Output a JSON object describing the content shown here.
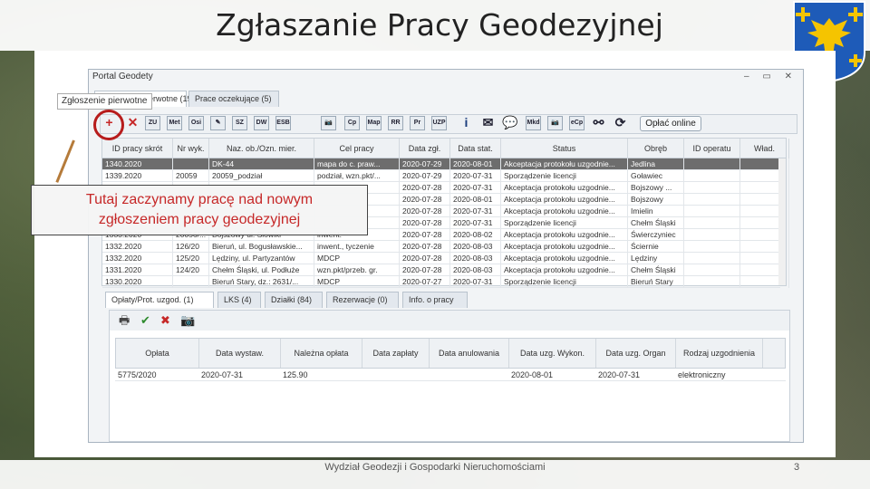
{
  "slide": {
    "title": "Zgłaszanie Pracy Geodezyjnej",
    "footer": "Wydział Geodezji i Gospodarki Nieruchomościami",
    "page": "3"
  },
  "window": {
    "title": "Portal Geodety",
    "controls": "– ▭ ✕"
  },
  "tabs": [
    {
      "label": "Zgłoszenie pierwotne (1900)"
    },
    {
      "label": "Prace oczekujące (5)"
    }
  ],
  "callout_tab": "Zgłoszenie pierwotne",
  "toolbar": {
    "icons": [
      "add-icon",
      "delete-icon",
      "zu-icon",
      "met-icon",
      "osi-icon",
      "edit-icon",
      "sz-icon",
      "dw-icon",
      "esb-icon",
      "camera-icon",
      "cp-icon",
      "map-icon",
      "rr-icon",
      "pr-icon",
      "uzp-icon",
      "info-icon",
      "mail-icon",
      "chat-icon",
      "mkd-icon",
      "photo-icon",
      "ecp-icon",
      "binoculars-icon",
      "refresh-icon"
    ],
    "labels": [
      "+",
      "✕",
      "ZU",
      "Met",
      "Osi",
      "✎",
      "SZ",
      "DW",
      "ESB",
      "📷",
      "Cp",
      "Map",
      "RR",
      "Pr",
      "UZP",
      "i",
      "✉",
      "💬",
      "Mkd",
      "📷",
      "eCp",
      "⚯",
      "⟳"
    ],
    "pay_button": "Opłać online"
  },
  "grid": {
    "headers": [
      "ID pracy skrót",
      "Nr wyk.",
      "Naz. ob./Ozn. mier.",
      "Cel pracy",
      "Data zgł.",
      "Data stat.",
      "Status",
      "Obręb",
      "ID operatu",
      "Wład."
    ],
    "rows": [
      [
        "1340.2020",
        "",
        "DK-44",
        "mapa do c. praw...",
        "2020-07-29",
        "2020-08-01",
        "Akceptacja protokołu uzgodnie...",
        "Jedlina",
        "",
        ""
      ],
      [
        "1339.2020",
        "20059",
        "20059_podział",
        "podział, wzn.pkt/...",
        "2020-07-29",
        "2020-07-31",
        "Sporządzenie licencji",
        "Goławiec",
        "",
        ""
      ],
      [
        "",
        "",
        "",
        "",
        "2020-07-28",
        "2020-07-31",
        "Akceptacja protokołu uzgodnie...",
        "Bojszowy ...",
        "",
        ""
      ],
      [
        "",
        "",
        "",
        "",
        "2020-07-28",
        "2020-08-01",
        "Akceptacja protokołu uzgodnie...",
        "Bojszowy",
        "",
        ""
      ],
      [
        "",
        "",
        "",
        "",
        "2020-07-28",
        "2020-07-31",
        "Akceptacja protokołu uzgodnie...",
        "Imielin",
        "",
        ""
      ],
      [
        "",
        "",
        "",
        "",
        "2020-07-28",
        "2020-07-31",
        "Sporządzenie licencji",
        "Chełm Śląski",
        "",
        ""
      ],
      [
        "1333.2020",
        "20056/...",
        "Bojszowy ul. Słowiki",
        "inwent.",
        "2020-07-28",
        "2020-08-02",
        "Akceptacja protokołu uzgodnie...",
        "Świerczyniec",
        "",
        ""
      ],
      [
        "1332.2020",
        "126/20",
        "Bieruń, ul. Bogusławskie...",
        "inwent., tyczenie",
        "2020-07-28",
        "2020-08-03",
        "Akceptacja protokołu uzgodnie...",
        "Ściernie",
        "",
        ""
      ],
      [
        "1332.2020",
        "125/20",
        "Lędziny, ul. Partyzantów",
        "MDCP",
        "2020-07-28",
        "2020-08-03",
        "Akceptacja protokołu uzgodnie...",
        "Lędziny",
        "",
        ""
      ],
      [
        "1331.2020",
        "124/20",
        "Chełm Śląski, ul. Podłuże",
        "wzn.pkt/przeb. gr.",
        "2020-07-28",
        "2020-08-03",
        "Akceptacja protokołu uzgodnie...",
        "Chełm Śląski",
        "",
        ""
      ],
      [
        "1330.2020",
        "",
        "Bieruń Stary, dz.: 2631/...",
        "MDCP",
        "2020-07-27",
        "2020-07-31",
        "Sporządzenie licencji",
        "Bieruń Stary",
        "",
        ""
      ]
    ]
  },
  "subtabs": [
    {
      "label": "Opłaty/Prot. uzgod. (1)"
    },
    {
      "label": "LKS (4)"
    },
    {
      "label": "Działki (84)"
    },
    {
      "label": "Rezerwacje (0)"
    },
    {
      "label": "Info. o pracy"
    }
  ],
  "subgrid": {
    "headers": [
      "Opłata",
      "Data wystaw.",
      "Należna opłata",
      "Data zapłaty",
      "Data anulowania",
      "Data uzg. Wykon.",
      "Data uzg. Organ",
      "Rodzaj uzgodnienia"
    ],
    "row": [
      "5775/2020",
      "2020-07-31",
      "125.90",
      "",
      "",
      "2020-08-01",
      "2020-07-31",
      "elektroniczny"
    ]
  },
  "callout": {
    "line1": "Tutaj zaczynamy pracę nad nowym",
    "line2": "zgłoszeniem pracy geodezyjnej"
  },
  "colors": {
    "highlight": "#b71c1c",
    "callout_text": "#c62828"
  }
}
